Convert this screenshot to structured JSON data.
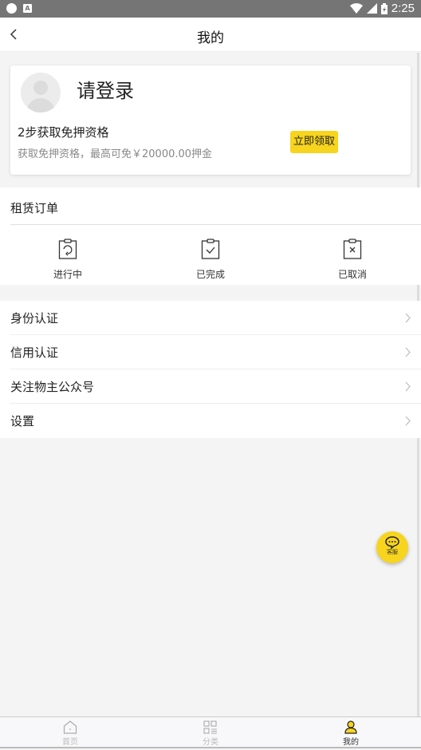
{
  "status_bar": {
    "time": "2:25"
  },
  "header": {
    "title": "我的",
    "back_icon": "chevron-left-icon"
  },
  "profile": {
    "login_prompt": "请登录",
    "promo_title": "2步获取免押资格",
    "promo_subtitle": "获取免押资格，最高可免￥20000.00押金",
    "claim_button": "立即领取"
  },
  "orders": {
    "title": "租赁订单",
    "items": [
      {
        "label": "进行中",
        "icon": "clipboard-refresh-icon"
      },
      {
        "label": "已完成",
        "icon": "clipboard-check-icon"
      },
      {
        "label": "已取消",
        "icon": "clipboard-x-icon"
      }
    ]
  },
  "menu": {
    "items": [
      {
        "label": "身份认证"
      },
      {
        "label": "信用认证"
      },
      {
        "label": "关注物主公众号"
      },
      {
        "label": "设置"
      }
    ]
  },
  "service_fab": {
    "label": "客服"
  },
  "tabbar": {
    "tabs": [
      {
        "label": "首页",
        "icon": "home-icon",
        "active": false
      },
      {
        "label": "分类",
        "icon": "category-icon",
        "active": false
      },
      {
        "label": "我的",
        "icon": "user-icon",
        "active": true
      }
    ]
  },
  "colors": {
    "accent": "#f7d41e",
    "statusbar": "#757575",
    "background": "#f4f4f4"
  }
}
